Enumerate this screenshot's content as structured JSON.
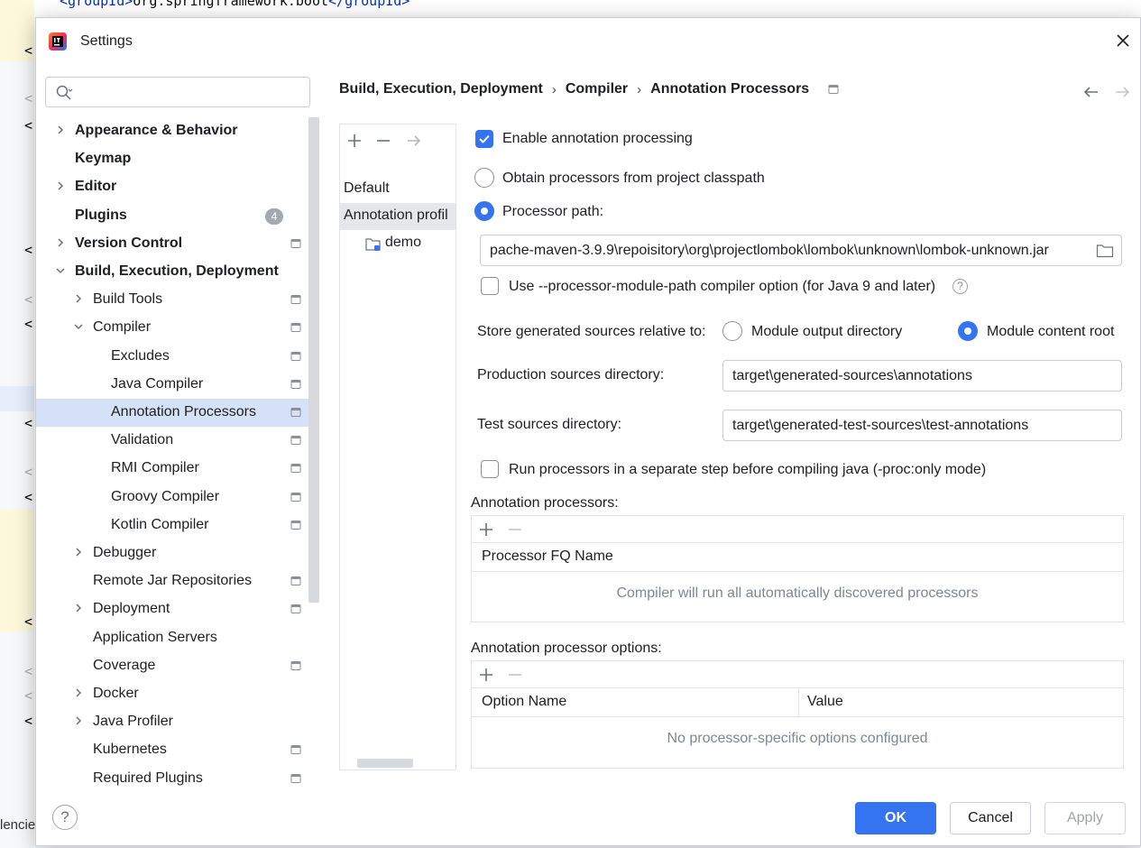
{
  "background": {
    "code_line": {
      "open_tag": "<groupId>",
      "text": "org.springframework.boot",
      "close_tag": "</groupId>"
    },
    "bottom_fragment": "lencie"
  },
  "dialog": {
    "title": "Settings",
    "search": {
      "placeholder": "",
      "value": ""
    }
  },
  "sidebar": {
    "items": [
      {
        "label": "Appearance & Behavior",
        "bold": true,
        "level": 0,
        "chevron": "right",
        "badge": "",
        "project_icon": false
      },
      {
        "label": "Keymap",
        "bold": true,
        "level": 0,
        "chevron": "",
        "badge": "",
        "project_icon": false
      },
      {
        "label": "Editor",
        "bold": true,
        "level": 0,
        "chevron": "right",
        "badge": "",
        "project_icon": false
      },
      {
        "label": "Plugins",
        "bold": true,
        "level": 0,
        "chevron": "",
        "badge": "4",
        "project_icon": false
      },
      {
        "label": "Version Control",
        "bold": true,
        "level": 0,
        "chevron": "right",
        "badge": "",
        "project_icon": true
      },
      {
        "label": "Build, Execution, Deployment",
        "bold": true,
        "level": 0,
        "chevron": "down",
        "badge": "",
        "project_icon": false
      },
      {
        "label": "Build Tools",
        "bold": false,
        "level": 1,
        "chevron": "right",
        "badge": "",
        "project_icon": true
      },
      {
        "label": "Compiler",
        "bold": false,
        "level": 1,
        "chevron": "down",
        "badge": "",
        "project_icon": true
      },
      {
        "label": "Excludes",
        "bold": false,
        "level": 2,
        "chevron": "",
        "badge": "",
        "project_icon": true
      },
      {
        "label": "Java Compiler",
        "bold": false,
        "level": 2,
        "chevron": "",
        "badge": "",
        "project_icon": true
      },
      {
        "label": "Annotation Processors",
        "bold": false,
        "level": 2,
        "chevron": "",
        "badge": "",
        "project_icon": true,
        "selected": true
      },
      {
        "label": "Validation",
        "bold": false,
        "level": 2,
        "chevron": "",
        "badge": "",
        "project_icon": true
      },
      {
        "label": "RMI Compiler",
        "bold": false,
        "level": 2,
        "chevron": "",
        "badge": "",
        "project_icon": true
      },
      {
        "label": "Groovy Compiler",
        "bold": false,
        "level": 2,
        "chevron": "",
        "badge": "",
        "project_icon": true
      },
      {
        "label": "Kotlin Compiler",
        "bold": false,
        "level": 2,
        "chevron": "",
        "badge": "",
        "project_icon": true
      },
      {
        "label": "Debugger",
        "bold": false,
        "level": 1,
        "chevron": "right",
        "badge": "",
        "project_icon": false
      },
      {
        "label": "Remote Jar Repositories",
        "bold": false,
        "level": 1,
        "chevron": "",
        "badge": "",
        "project_icon": true
      },
      {
        "label": "Deployment",
        "bold": false,
        "level": 1,
        "chevron": "right",
        "badge": "",
        "project_icon": true
      },
      {
        "label": "Application Servers",
        "bold": false,
        "level": 1,
        "chevron": "",
        "badge": "",
        "project_icon": false
      },
      {
        "label": "Coverage",
        "bold": false,
        "level": 1,
        "chevron": "",
        "badge": "",
        "project_icon": true
      },
      {
        "label": "Docker",
        "bold": false,
        "level": 1,
        "chevron": "right",
        "badge": "",
        "project_icon": false
      },
      {
        "label": "Java Profiler",
        "bold": false,
        "level": 1,
        "chevron": "right",
        "badge": "",
        "project_icon": false
      },
      {
        "label": "Kubernetes",
        "bold": false,
        "level": 1,
        "chevron": "",
        "badge": "",
        "project_icon": true
      },
      {
        "label": "Required Plugins",
        "bold": false,
        "level": 1,
        "chevron": "",
        "badge": "",
        "project_icon": true
      }
    ]
  },
  "breadcrumb": {
    "items": [
      "Build, Execution, Deployment",
      "Compiler",
      "Annotation Processors"
    ],
    "separator": "›"
  },
  "profiles": {
    "items": [
      {
        "label": "Default"
      },
      {
        "label": "Annotation profil",
        "selected": true
      },
      {
        "label": "demo"
      }
    ]
  },
  "form": {
    "enable_processing": {
      "label": "Enable annotation processing",
      "checked": true
    },
    "obtain_classpath": {
      "label": "Obtain processors from project classpath",
      "checked": false
    },
    "processor_path": {
      "label": "Processor path:",
      "checked": true,
      "value": "pache-maven-3.9.9\\repoisitory\\org\\projectlombok\\lombok\\unknown\\lombok-unknown.jar"
    },
    "module_path_option": {
      "label": "Use --processor-module-path compiler option (for Java 9 and later)",
      "checked": false
    },
    "store_generated": {
      "label": "Store generated sources relative to:",
      "option_output": "Module output directory",
      "option_content_root": "Module content root",
      "selected": "Module content root"
    },
    "production_sources": {
      "label": "Production sources directory:",
      "value": "target\\generated-sources\\annotations"
    },
    "test_sources": {
      "label": "Test sources directory:",
      "value": "target\\generated-test-sources\\test-annotations"
    },
    "separate_step": {
      "label": "Run processors in a separate step before compiling java (-proc:only mode)",
      "checked": false
    }
  },
  "annotation_processors": {
    "title": "Annotation processors:",
    "column": "Processor FQ Name",
    "empty_text": "Compiler will run all automatically discovered processors"
  },
  "processor_options": {
    "title": "Annotation processor options:",
    "columns": [
      "Option Name",
      "Value"
    ],
    "empty_text": "No processor-specific options configured"
  },
  "footer": {
    "help": "?",
    "ok": "OK",
    "cancel": "Cancel",
    "apply": "Apply"
  },
  "colors": {
    "accent": "#3574f0",
    "selection": "#d5e1f7",
    "border": "#c9ccd6",
    "muted_text": "#818594"
  }
}
